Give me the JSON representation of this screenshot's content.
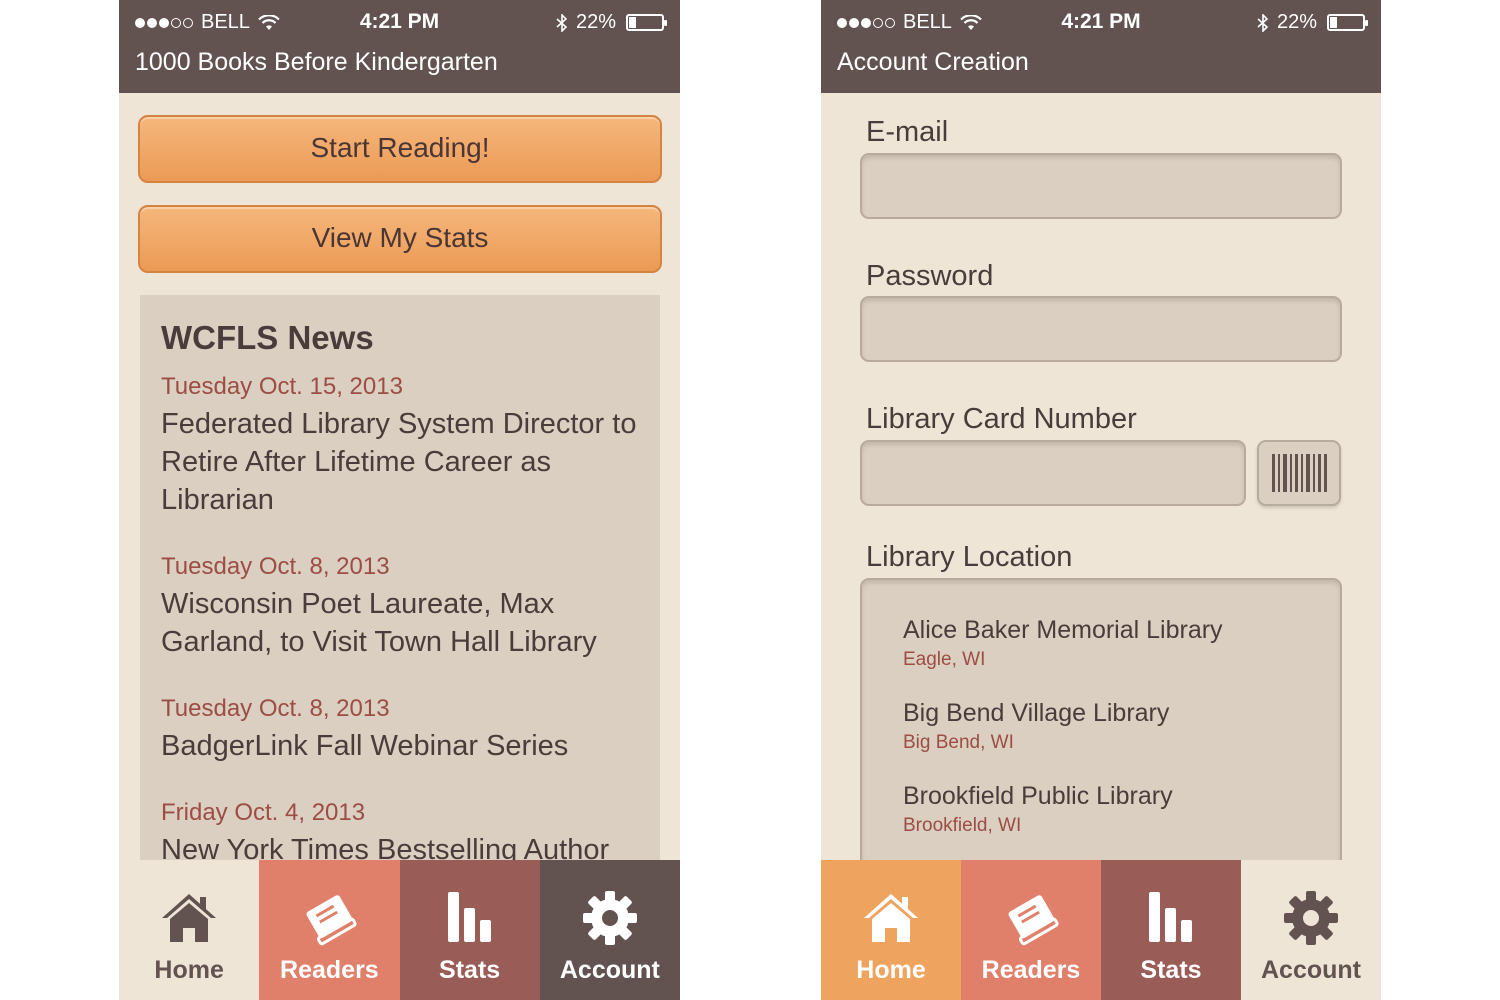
{
  "colors": {
    "header": "#625351",
    "background": "#efe5d7",
    "panel": "#dbcfc1",
    "orange": "#eea35f",
    "coral": "#e0806a",
    "brick": "#9a5c56",
    "dark": "#625351",
    "date_red": "#9c4d44"
  },
  "status": {
    "carrier": "BELL",
    "time": "4:21 PM",
    "battery": "22%",
    "battery_level": 0.22
  },
  "home_screen": {
    "title": "1000 Books Before Kindergarten",
    "start_reading_label": "Start Reading!",
    "view_stats_label": "View My Stats",
    "news": {
      "heading": "WCFLS News",
      "items": [
        {
          "date": "Tuesday Oct. 15, 2013",
          "headline": "Federated Library System Director to Retire After Lifetime Career as Librarian"
        },
        {
          "date": "Tuesday Oct. 8, 2013",
          "headline": "Wisconsin Poet Laureate, Max Garland, to Visit Town Hall Library"
        },
        {
          "date": "Tuesday Oct. 8, 2013",
          "headline": "BadgerLink Fall Webinar Series"
        },
        {
          "date": "Friday Oct. 4, 2013",
          "headline": "New York Times Bestselling Author"
        }
      ]
    }
  },
  "account_screen": {
    "title": "Account Creation",
    "email_label": "E-mail",
    "email_value": "",
    "password_label": "Password",
    "password_value": "",
    "card_label": "Library Card Number",
    "card_value": "",
    "location_label": "Library Location",
    "locations": [
      {
        "name": "Alice Baker Memorial Library",
        "city": "Eagle, WI"
      },
      {
        "name": "Big Bend Village Library",
        "city": "Big Bend, WI"
      },
      {
        "name": "Brookfield Public Library",
        "city": "Brookfield, WI"
      }
    ]
  },
  "tabs": [
    {
      "label": "Home",
      "icon": "home-icon"
    },
    {
      "label": "Readers",
      "icon": "book-icon"
    },
    {
      "label": "Stats",
      "icon": "bar-chart-icon"
    },
    {
      "label": "Account",
      "icon": "gear-icon"
    }
  ]
}
